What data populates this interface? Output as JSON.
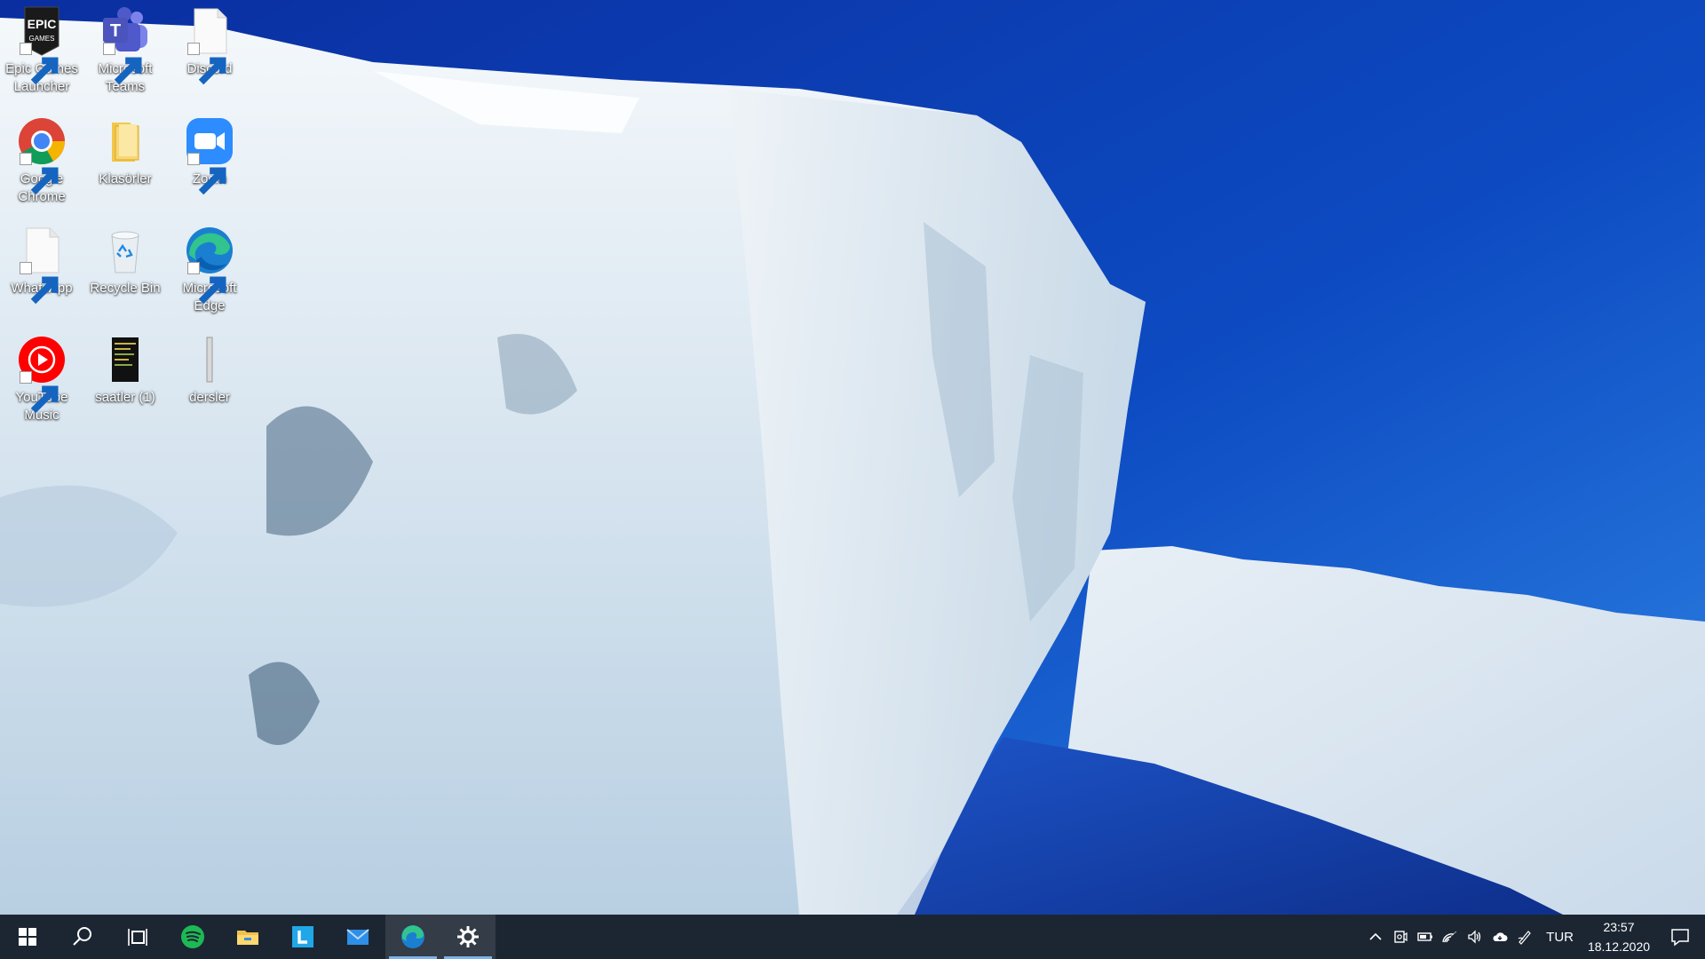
{
  "desktop": {
    "icons": [
      {
        "label": "Epic Games Launcher",
        "icon": "epic-games-icon"
      },
      {
        "label": "Microsoft Teams",
        "icon": "teams-icon"
      },
      {
        "label": "Discord",
        "icon": "blank-file-icon"
      },
      {
        "label": "Google Chrome",
        "icon": "chrome-icon"
      },
      {
        "label": "Klasörler",
        "icon": "folder-icon"
      },
      {
        "label": "Zoom",
        "icon": "zoom-icon"
      },
      {
        "label": "WhatsApp",
        "icon": "blank-file-icon"
      },
      {
        "label": "Recycle Bin",
        "icon": "recycle-bin-icon"
      },
      {
        "label": "Microsoft Edge",
        "icon": "edge-icon"
      },
      {
        "label": "YouTube Music",
        "icon": "youtube-music-icon"
      },
      {
        "label": "saatler (1)",
        "icon": "text-file-icon"
      },
      {
        "label": "dersler",
        "icon": "file-icon"
      }
    ]
  },
  "taskbar": {
    "pinned": [
      {
        "name": "start",
        "icon": "windows-logo-icon"
      },
      {
        "name": "search",
        "icon": "search-icon"
      },
      {
        "name": "task-view",
        "icon": "task-view-icon"
      },
      {
        "name": "spotify",
        "icon": "spotify-icon"
      },
      {
        "name": "file-explorer",
        "icon": "folder-icon"
      },
      {
        "name": "l-app",
        "icon": "l-app-icon",
        "letter": "L"
      },
      {
        "name": "mail",
        "icon": "mail-icon"
      },
      {
        "name": "edge",
        "icon": "edge-icon"
      },
      {
        "name": "settings",
        "icon": "gear-icon"
      }
    ],
    "tray": {
      "language": "TUR",
      "time": "23:57",
      "date": "18.12.2020"
    }
  },
  "colors": {
    "taskbar_bg": "#1c2633",
    "sky": "#0b3fb0",
    "active_indicator": "#7db2e8"
  }
}
